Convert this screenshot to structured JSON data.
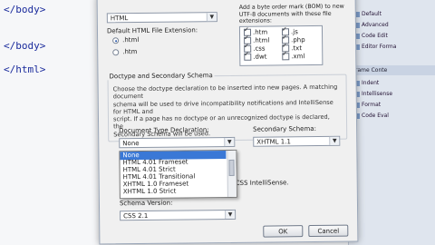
{
  "editor": {
    "lines": [
      "</body>",
      "</body>",
      "</html>"
    ]
  },
  "right_panel": {
    "items": [
      "Default",
      "Advanced",
      "Code Edit",
      "Editor Forma",
      "Indent",
      "Intellisense",
      "Format",
      "Code Eval"
    ],
    "header": "Frame Conte"
  },
  "dialog": {
    "top_select_value": "HTML",
    "default_ext_label": "Default HTML File Extension:",
    "radio_html": ".html",
    "radio_htm": ".htm",
    "bom_label": "Add a byte order mark (BOM) to new UTF-8 documents with these file extensions:",
    "extensions_col1": [
      ".htm",
      ".html",
      ".css",
      ".dwt"
    ],
    "extensions_col2": [
      ".js",
      ".php",
      ".txt",
      ".xml"
    ],
    "doctype_group_title": "Doctype and Secondary Schema",
    "doctype_description": "Choose the doctype declaration to be inserted into new pages. A matching document\nschema will be used to drive incompatibility notifications and IntelliSense for HTML and\nscript. If a page has no doctype or an unrecognized doctype is declared, the\nSecondary Schema will be used.",
    "doctype_label": "Document Type Declaration:",
    "doctype_value": "None",
    "secondary_label": "Secondary Schema:",
    "secondary_value": "XHTML 1.1",
    "doctype_options": [
      "None",
      "HTML 4.01 Frameset",
      "HTML 4.01 Strict",
      "HTML 4.01 Transitional",
      "XHTML 1.0 Frameset",
      "XHTML 1.0 Strict"
    ],
    "css_intellisense_text": "CSS IntelliSense.",
    "schema_version_label": "Schema Version:",
    "schema_version_value": "CSS 2.1",
    "ok_label": "OK",
    "cancel_label": "Cancel"
  }
}
